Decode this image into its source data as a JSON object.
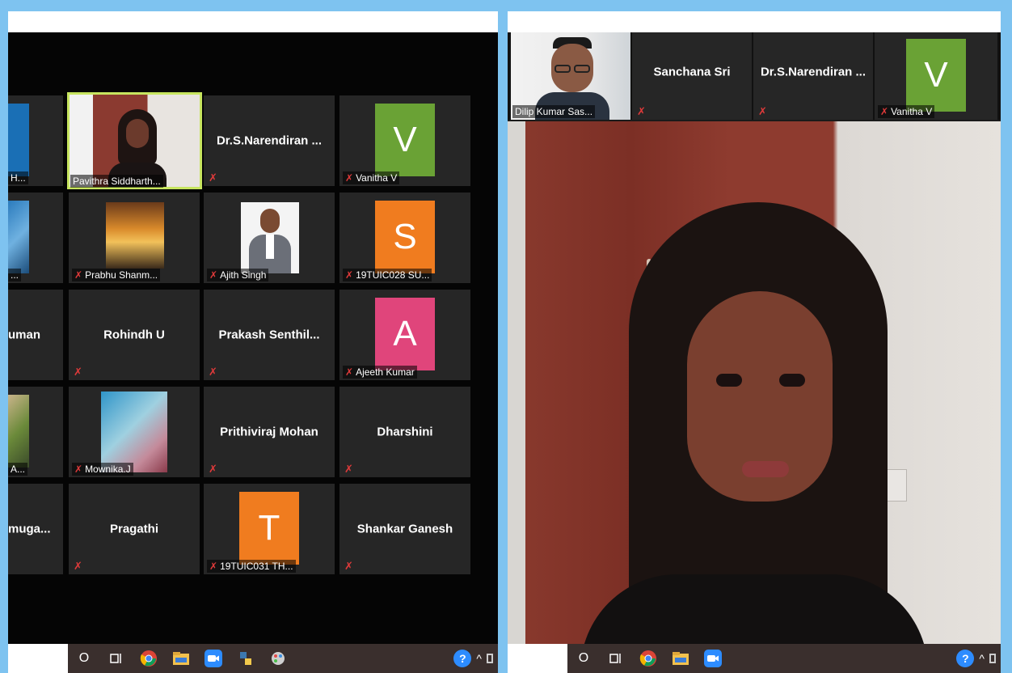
{
  "left_gallery": {
    "tiles": [
      {
        "name": "",
        "label": "H..."
      },
      {
        "name": "",
        "label": "Pavithra Siddharth..."
      },
      {
        "name": "Dr.S.Narendiran ...",
        "label": ""
      },
      {
        "name": "",
        "label": "Vanitha V",
        "avatar_letter": "V",
        "avatar_color": "#6aa235"
      },
      {
        "name": "",
        "label": "..."
      },
      {
        "name": "",
        "label": "Prabhu Shanm..."
      },
      {
        "name": "",
        "label": "Ajith Singh"
      },
      {
        "name": "",
        "label": "19TUIC028 SU...",
        "avatar_letter": "S",
        "avatar_color": "#f07c1f"
      },
      {
        "name": "uman",
        "label": ""
      },
      {
        "name": "Rohindh U",
        "label": ""
      },
      {
        "name": "Prakash  Senthil...",
        "label": ""
      },
      {
        "name": "",
        "label": "Ajeeth Kumar",
        "avatar_letter": "A",
        "avatar_color": "#e0457b"
      },
      {
        "name": "",
        "label": "A..."
      },
      {
        "name": "",
        "label": "Mownika.J"
      },
      {
        "name": "Prithiviraj Mohan",
        "label": ""
      },
      {
        "name": "Dharshini",
        "label": ""
      },
      {
        "name": "muga...",
        "label": ""
      },
      {
        "name": "Pragathi",
        "label": ""
      },
      {
        "name": "",
        "label": "19TUIC031 TH...",
        "avatar_letter": "T",
        "avatar_color": "#f07c1f"
      },
      {
        "name": "Shankar Ganesh",
        "label": ""
      }
    ]
  },
  "right_strip": {
    "tiles": [
      {
        "name": "",
        "label": "Dilip Kumar Sas..."
      },
      {
        "name": "Sanchana Sri",
        "label": ""
      },
      {
        "name": "Dr.S.Narendiran ...",
        "label": ""
      },
      {
        "name": "",
        "label": "Vanitha V",
        "avatar_letter": "V",
        "avatar_color": "#6aa235"
      }
    ]
  },
  "taskbar": {
    "icons": [
      "search-circle-icon",
      "task-view-icon",
      "chrome-icon",
      "file-explorer-icon",
      "zoom-icon",
      "python-icon",
      "paint-icon"
    ],
    "tray_icons": [
      "help-icon",
      "chevron-up-icon",
      "network-icon"
    ],
    "search_glyph": "O",
    "help_glyph": "?",
    "chevron_glyph": "^"
  },
  "colors": {
    "background": "#7ec3f0",
    "active_speaker_border": "#c7e55f",
    "muted_mic": "#e03a3a",
    "tile_bg": "#262626"
  },
  "glyphs": {
    "mic_muted": "✗"
  }
}
